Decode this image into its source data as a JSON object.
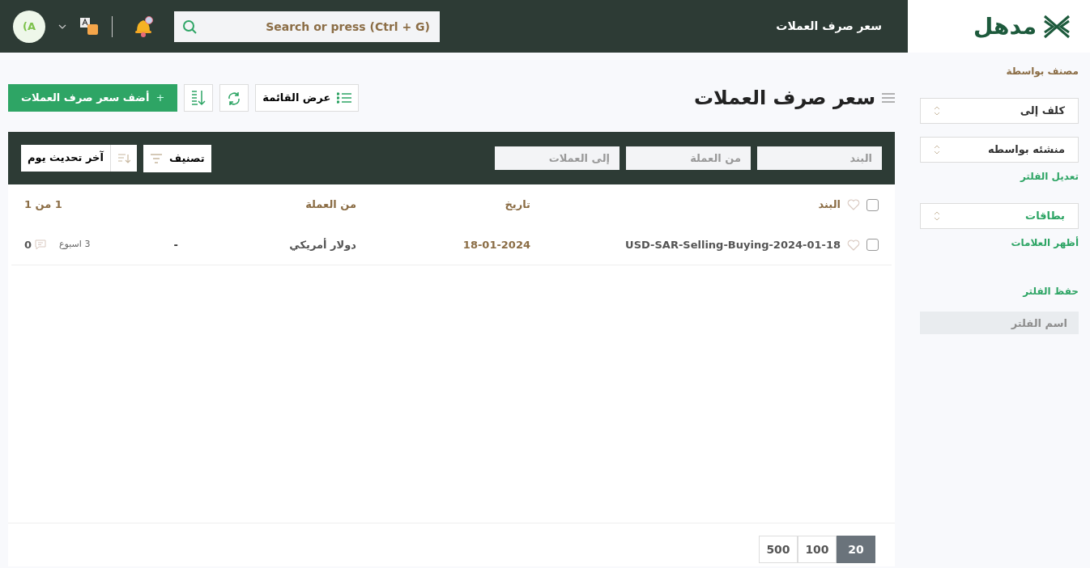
{
  "brand": {
    "logo_text": "مدهل"
  },
  "topbar": {
    "title": "سعر صرف العملات",
    "search": {
      "placeholder": "Search or press (Ctrl + G)"
    },
    "avatar": "A)"
  },
  "sidebar": {
    "heading": "مصنف بواسطة",
    "selects": [
      {
        "value": "كلف إلى",
        "highlight": false
      },
      {
        "value": "منشئه بواسطه",
        "highlight": false
      }
    ],
    "edit_filter_link": "تعديل الفلتر",
    "view_select": {
      "value": "بطاقات",
      "highlight": true
    },
    "show_tags_link": "أظهر العلامات",
    "save_filter_label": "حفظ الفلتر",
    "filter_name": {
      "placeholder": "اسم الفلتر"
    }
  },
  "page": {
    "title": "سعر صرف العملات",
    "list_view_button": "عرض القائمة",
    "add_button": {
      "icon": "+",
      "label": "أضف سعر صرف العملات"
    }
  },
  "filters": {
    "fields": [
      {
        "placeholder": "البند"
      },
      {
        "placeholder": "من العملة"
      },
      {
        "placeholder": "إلى العملات"
      }
    ],
    "sort_button": "تصنيف",
    "sort_order": "آخر تحديث يوم"
  },
  "table": {
    "all_checked": false,
    "columns": [
      "البند",
      "تاريخ",
      "من العملة"
    ],
    "count": "1 من 1",
    "rows": [
      {
        "checked": false,
        "liked": false,
        "item": "USD-SAR-Selling-Buying-2024-01-18",
        "date": "18-01-2024",
        "from_currency": "دولار أمريكي",
        "column_4": "-",
        "age": "3 اسبوع",
        "comments": "0"
      }
    ]
  },
  "page_sizes": [
    {
      "label": "20",
      "selected": true
    },
    {
      "label": "100",
      "selected": false
    },
    {
      "label": "500",
      "selected": false
    }
  ]
}
